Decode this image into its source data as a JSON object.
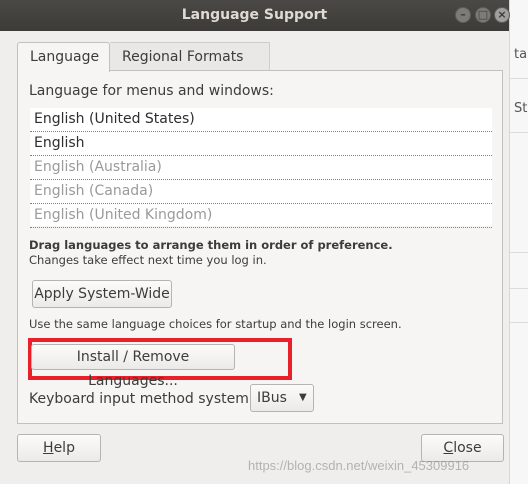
{
  "window": {
    "title": "Language Support"
  },
  "background_window": {
    "text1": "ta",
    "text2": "St"
  },
  "tabs": [
    {
      "label": "Language"
    },
    {
      "label": "Regional Formats"
    }
  ],
  "language": {
    "heading": "Language for menus and windows:",
    "items": [
      {
        "label": "English (United States)",
        "active": true
      },
      {
        "label": "English",
        "active": true
      },
      {
        "label": "English (Australia)",
        "active": false
      },
      {
        "label": "English (Canada)",
        "active": false
      },
      {
        "label": "English (United Kingdom)",
        "active": false
      }
    ],
    "hint_bold": "Drag languages to arrange them in order of preference.",
    "hint": "Changes take effect next time you log in.",
    "apply_label": "Apply System-Wide",
    "note": "Use the same language choices for startup and the login screen.",
    "install_label": "Install / Remove Languages...",
    "keyboard_label": "Keyboard input method system:",
    "keyboard_value": "IBus"
  },
  "footer": {
    "help_mnemonic": "H",
    "help_rest": "elp",
    "close_mnemonic": "C",
    "close_rest": "lose"
  },
  "watermark": "https://blog.csdn.net/weixin_45309916",
  "colors": {
    "highlight": "#e8202a",
    "titlebar": "#3c3b37"
  }
}
